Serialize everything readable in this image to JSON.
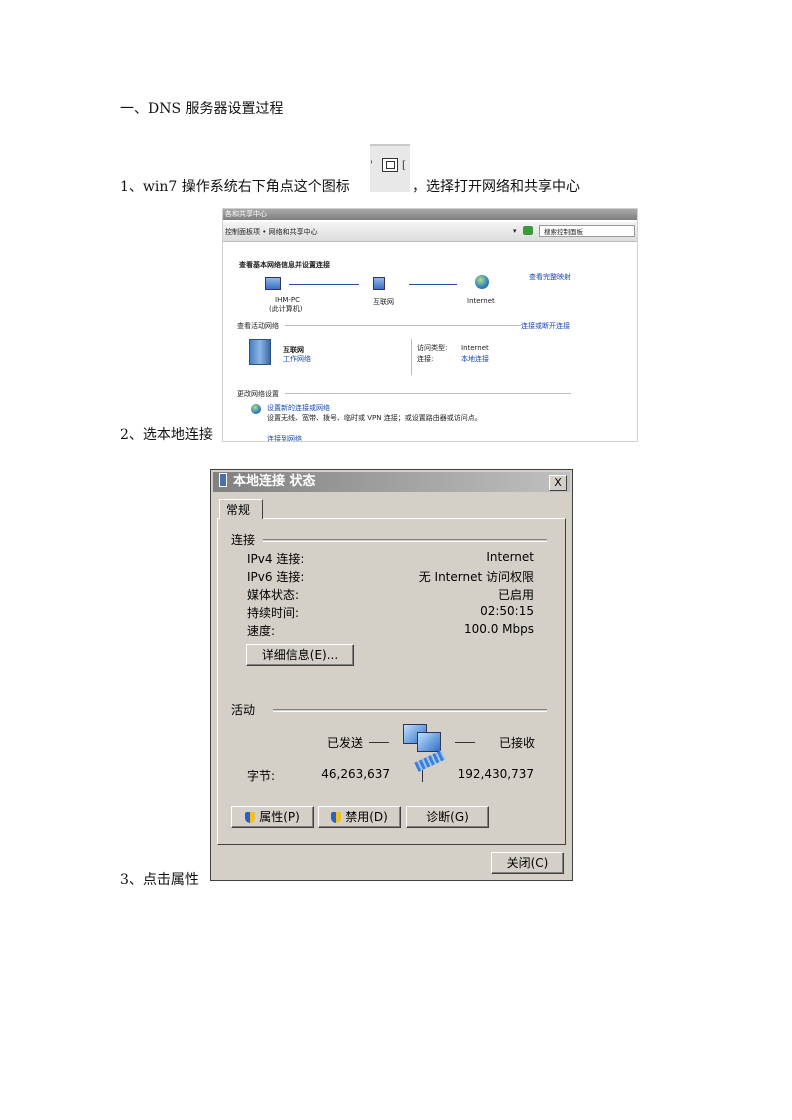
{
  "doc": {
    "heading": "一、DNS 服务器设置过程",
    "step1_before": "1、win7 操作系统右下角点这个图标",
    "step1_after": "，选择打开网络和共享中心",
    "step2": "2、选本地连接",
    "step3": "3、点击属性"
  },
  "net_center": {
    "window_title": "各和共享中心",
    "breadcrumb": "控制面板项 • 网络和共享中心",
    "search_placeholder": "搜索控制面板",
    "heading": "查看基本网络信息并设置连接",
    "full_map_link": "查看完整映射",
    "node_pc_name": "IHM-PC",
    "node_pc_sub": "(此计算机)",
    "node_net": "互联网",
    "node_internet": "Internet",
    "active_label": "查看活动网络",
    "connect_link": "连接或断开连接",
    "active_name": "互联网",
    "active_type": "工作网络",
    "access_label": "访问类型:",
    "access_value": "Internet",
    "conn_label": "连接:",
    "conn_value": "本地连接",
    "change_label": "更改网络设置",
    "setup_link": "设置新的连接或网络",
    "setup_desc": "设置无线、宽带、拨号、临时或 VPN 连接；或设置路由器或访问点。",
    "partial_link": "连接到网络"
  },
  "dialog": {
    "title": "本地连接 状态",
    "close_x": "X",
    "tab": "常规",
    "section_conn": "连接",
    "rows": [
      {
        "label": "IPv4 连接:",
        "value": "Internet"
      },
      {
        "label": "IPv6 连接:",
        "value": "无 Internet 访问权限"
      },
      {
        "label": "媒体状态:",
        "value": "已启用"
      },
      {
        "label": "持续时间:",
        "value": "02:50:15"
      },
      {
        "label": "速度:",
        "value": "100.0 Mbps"
      }
    ],
    "details_button": "详细信息(E)...",
    "section_activity": "活动",
    "sent_label": "已发送",
    "recv_label": "已接收",
    "bytes_label": "字节:",
    "bytes_sent": "46,263,637",
    "bytes_recv": "192,430,737",
    "properties_button": "属性(P)",
    "disable_button": "禁用(D)",
    "diagnose_button": "诊断(G)",
    "close_button": "关闭(C)"
  }
}
